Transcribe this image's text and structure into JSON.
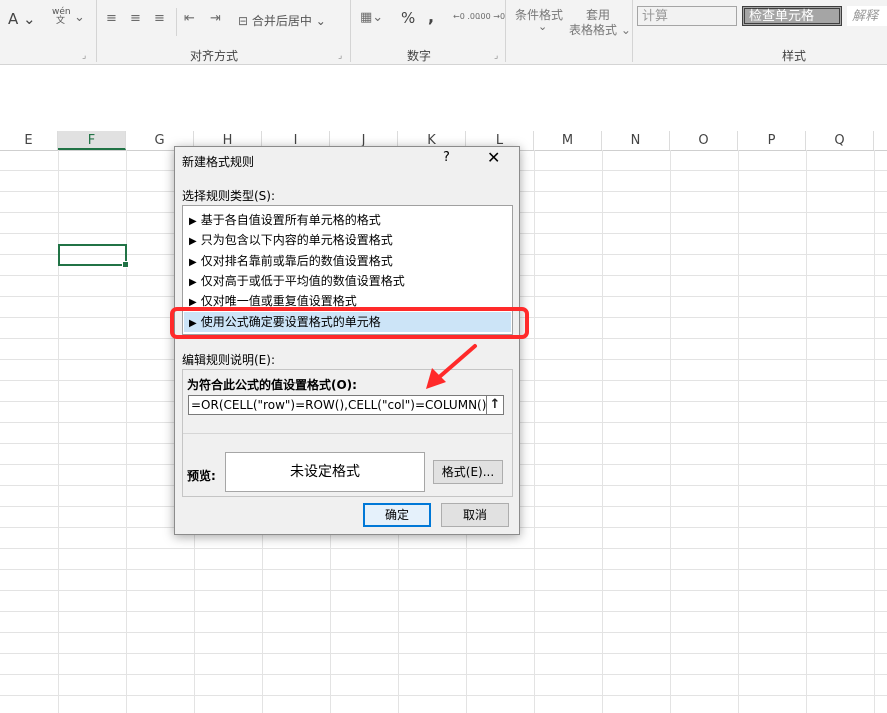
{
  "ribbon": {
    "font_color_glyph": "A",
    "phonetic_glyph_top": "wén",
    "phonetic_glyph_bottom": "文",
    "merge_center": "合并后居中",
    "percent": "%",
    "comma": ",",
    "decimal_inc": "←0 .00",
    "decimal_dec": ".00 →0",
    "conditional_format": "条件格式",
    "table_format_top": "套用",
    "table_format": "表格格式",
    "style_calc": "计算",
    "style_check_cell": "检查单元格",
    "style_explain": "解释",
    "group_alignment": "对齐方式",
    "group_number": "数字",
    "group_styles": "样式"
  },
  "sheet": {
    "columns": [
      "E",
      "F",
      "G",
      "H",
      "I",
      "J",
      "K",
      "L",
      "M",
      "N",
      "O",
      "P",
      "Q"
    ],
    "selected_column": "F"
  },
  "dialog": {
    "title": "新建格式规则",
    "help": "?",
    "close": "✕",
    "select_rule_type_label": "选择规则类型(S):",
    "rule_types": [
      "基于各自值设置所有单元格的格式",
      "只为包含以下内容的单元格设置格式",
      "仅对排名靠前或靠后的数值设置格式",
      "仅对高于或低于平均值的数值设置格式",
      "仅对唯一值或重复值设置格式",
      "使用公式确定要设置格式的单元格"
    ],
    "selected_rule_index": 5,
    "edit_rule_label": "编辑规则说明(E):",
    "formula_label": "为符合此公式的值设置格式(O):",
    "formula_value": "=OR(CELL(\"row\")=ROW(),CELL(\"col\")=COLUMN())",
    "collapse_icon_glyph": "↑",
    "preview_label": "预览:",
    "preview_text": "未设定格式",
    "format_button": "格式(E)...",
    "ok_button": "确定",
    "cancel_button": "取消"
  },
  "colors": {
    "excel_green": "#217346",
    "highlight_red": "#ff2a2a",
    "selection_blue": "#cce4f7",
    "default_button_border": "#0078d7"
  }
}
